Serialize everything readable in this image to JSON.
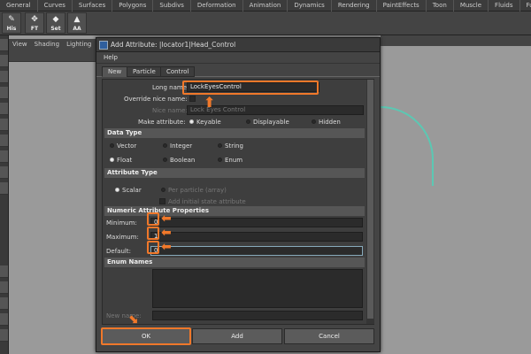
{
  "shelf_tabs": [
    "General",
    "Curves",
    "Surfaces",
    "Polygons",
    "Subdivs",
    "Deformation",
    "Animation",
    "Dynamics",
    "Rendering",
    "PaintEffects",
    "Toon",
    "Muscle",
    "Fluids",
    "Fur"
  ],
  "shelf_icons": [
    "His",
    "FT",
    "Set",
    "AA"
  ],
  "panel_menu": [
    "View",
    "Shading",
    "Lighting"
  ],
  "dialog": {
    "title": "Add Attribute: |locator1|Head_Control",
    "menu": "Help",
    "tabs": [
      "New",
      "Particle",
      "Control"
    ],
    "long_name_label": "Long name:",
    "long_name_value": "LockEyesControl",
    "override_label": "Override nice name:",
    "nice_name_label": "Nice name:",
    "nice_name_value": "Lock Eyes Control",
    "make_attr_label": "Make attribute:",
    "make_attr_options": [
      "Keyable",
      "Displayable",
      "Hidden"
    ],
    "data_type_header": "Data Type",
    "data_types": [
      "Vector",
      "Integer",
      "String",
      "Float",
      "Boolean",
      "Enum"
    ],
    "attr_type_header": "Attribute Type",
    "attr_types": [
      "Scalar",
      "Per particle (array)"
    ],
    "add_initial": "Add initial state attribute",
    "numeric_header": "Numeric Attribute Properties",
    "minimum_label": "Minimum:",
    "minimum_value": "0",
    "maximum_label": "Maximum:",
    "maximum_value": "1",
    "default_label": "Default:",
    "default_value": "0",
    "enum_header": "Enum Names",
    "new_name_label": "New name:",
    "buttons": {
      "ok": "OK",
      "add": "Add",
      "cancel": "Cancel"
    }
  },
  "colors": {
    "highlight": "#f0782a",
    "curve": "#5bc8b3"
  }
}
